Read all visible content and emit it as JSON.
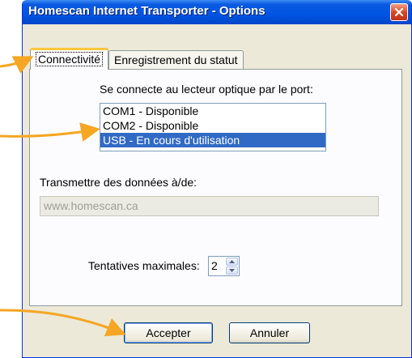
{
  "window": {
    "title": "Homescan Internet Transporter - Options"
  },
  "tabs": [
    {
      "label": "Connectivité",
      "active": true
    },
    {
      "label": "Enregistrement du statut",
      "active": false
    }
  ],
  "port": {
    "label": "Se connecte au lecteur optique par le port:",
    "options": [
      "COM1 - Disponible",
      "COM2 - Disponible",
      "USB - En cours d'utilisation"
    ],
    "selected_index": 2
  },
  "transfer": {
    "label": "Transmettre des données à/de:",
    "value": "www.homescan.ca",
    "disabled": true
  },
  "attempts": {
    "label": "Tentatives maximales:",
    "value": "2"
  },
  "buttons": {
    "accept": "Accepter",
    "cancel": "Annuler"
  },
  "colors": {
    "titlebar": "#0054e3",
    "selection": "#316ac5",
    "annotation_arrow": "#f5a623",
    "close_button": "#d9421f"
  },
  "icons": [
    "close-icon",
    "spin-up-icon",
    "spin-down-icon"
  ]
}
